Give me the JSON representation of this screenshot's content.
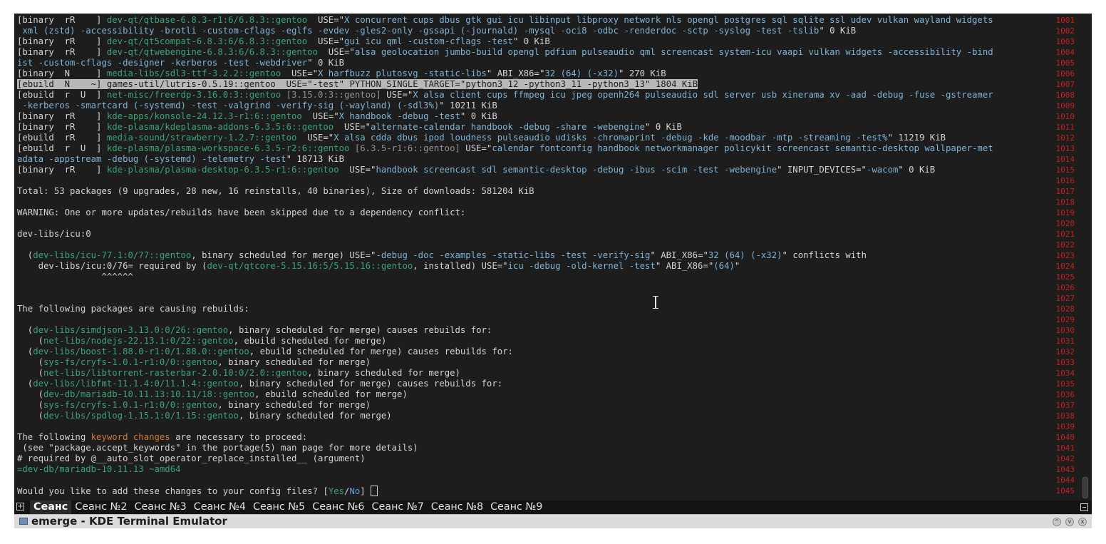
{
  "window": {
    "title": "emerge - KDE Terminal Emulator"
  },
  "tabs": [
    "Сеанс",
    "Сеанс №2",
    "Сеанс №3",
    "Сеанс №4",
    "Сеанс №5",
    "Сеанс №6",
    "Сеанс №7",
    "Сеанс №8",
    "Сеанс №9"
  ],
  "active_tab": 0,
  "terminal_lines": [
    {
      "segs": [
        [
          "[binary  rR    ] ",
          "t"
        ],
        [
          "dev-qt/qtbase-6.8.3-r1:6/6.8.3::gentoo",
          "p"
        ],
        [
          "  USE=\"",
          "t"
        ],
        [
          "X concurrent cups dbus gtk gui icu libinput libproxy network nls opengl postgres sql sqlite ssl udev vulkan wayland widgets",
          "u"
        ]
      ]
    },
    {
      "segs": [
        [
          " xml (zstd) -accessibility -brotli -custom-cflags -eglfs -evdev -gles2-only -gssapi (-journald) -mysql -oci8 -odbc -renderdoc -sctp -syslog -test -tslib",
          "u"
        ],
        [
          "\" 0 KiB",
          "t"
        ]
      ]
    },
    {
      "segs": [
        [
          "[binary  rR    ] ",
          "t"
        ],
        [
          "dev-qt/qt5compat-6.8.3:6/6.8.3::gentoo",
          "p"
        ],
        [
          "  USE=\"",
          "t"
        ],
        [
          "gui icu qml -custom-cflags -test",
          "u"
        ],
        [
          "\" 0 KiB",
          "t"
        ]
      ]
    },
    {
      "segs": [
        [
          "[binary  rR    ] ",
          "t"
        ],
        [
          "dev-qt/qtwebengine-6.8.3:6/6.8.3::gentoo",
          "p"
        ],
        [
          "  USE=\"",
          "t"
        ],
        [
          "alsa geolocation jumbo-build opengl pdfium pulseaudio qml screencast system-icu vaapi vulkan widgets -accessibility -bind",
          "u"
        ]
      ]
    },
    {
      "segs": [
        [
          "ist -custom-cflags -designer -kerberos -test -webdriver",
          "u"
        ],
        [
          "\" 0 KiB",
          "t"
        ]
      ]
    },
    {
      "segs": [
        [
          "[binary  N     ] ",
          "t"
        ],
        [
          "media-libs/sdl3-ttf-3.2.2::gentoo",
          "p"
        ],
        [
          "  USE=\"",
          "t"
        ],
        [
          "X harfbuzz plutosvg -static-libs",
          "u"
        ],
        [
          "\" ABI_X86=\"",
          "t"
        ],
        [
          "32 (64) (-x32)",
          "u"
        ],
        [
          "\" 270 KiB",
          "t"
        ]
      ]
    },
    {
      "hl": true,
      "segs": [
        [
          "[ebuild  N    ~] ",
          "t"
        ],
        [
          "games-util/lutris-0.5.19::gentoo",
          "p"
        ],
        [
          "  USE=\"",
          "t"
        ],
        [
          "-test",
          "u"
        ],
        [
          "\" PYTHON_SINGLE_TARGET=\"",
          "t"
        ],
        [
          "python3_12 -python3_11 -python3_13",
          "u"
        ],
        [
          "\" 1804 KiB",
          "t"
        ]
      ]
    },
    {
      "segs": [
        [
          "[ebuild  r  U  ] ",
          "t"
        ],
        [
          "net-misc/freerdp-3.16.0:3::gentoo",
          "p"
        ],
        [
          " [3.15.0:3::gentoo]",
          "d"
        ],
        [
          " USE=\"",
          "t"
        ],
        [
          "X alsa client cups ffmpeg icu jpeg openh264 pulseaudio sdl server usb xinerama xv -aad -debug -fuse -gstreamer",
          "u"
        ]
      ]
    },
    {
      "segs": [
        [
          " -kerberos -smartcard (-systemd) -test -valgrind -verify-sig (-wayland) (-sdl3%)",
          "u"
        ],
        [
          "\" 10211 KiB",
          "t"
        ]
      ]
    },
    {
      "segs": [
        [
          "[binary  rR    ] ",
          "t"
        ],
        [
          "kde-apps/konsole-24.12.3-r1:6::gentoo",
          "p"
        ],
        [
          "  USE=\"",
          "t"
        ],
        [
          "X handbook -debug -test",
          "u"
        ],
        [
          "\" 0 KiB",
          "t"
        ]
      ]
    },
    {
      "segs": [
        [
          "[binary  rR    ] ",
          "t"
        ],
        [
          "kde-plasma/kdeplasma-addons-6.3.5:6::gentoo",
          "p"
        ],
        [
          "  USE=\"",
          "t"
        ],
        [
          "alternate-calendar handbook -debug -share -webengine",
          "u"
        ],
        [
          "\" 0 KiB",
          "t"
        ]
      ]
    },
    {
      "segs": [
        [
          "[ebuild  rR    ] ",
          "t"
        ],
        [
          "media-sound/strawberry-1.2.7::gentoo",
          "p"
        ],
        [
          "  USE=\"",
          "t"
        ],
        [
          "X alsa cdda dbus ipod loudness pulseaudio udisks -chromaprint -debug -kde -moodbar -mtp -streaming -test%",
          "u"
        ],
        [
          "\" 11219 KiB",
          "t"
        ]
      ]
    },
    {
      "segs": [
        [
          "[ebuild  r  U  ] ",
          "t"
        ],
        [
          "kde-plasma/plasma-workspace-6.3.5-r2:6::gentoo",
          "p"
        ],
        [
          " [6.3.5-r1:6::gentoo]",
          "d"
        ],
        [
          " USE=\"",
          "t"
        ],
        [
          "calendar fontconfig handbook networkmanager policykit screencast semantic-desktop wallpaper-met",
          "u"
        ]
      ]
    },
    {
      "segs": [
        [
          "adata -appstream -debug (-systemd) -telemetry -test",
          "u"
        ],
        [
          "\" 18713 KiB",
          "t"
        ]
      ]
    },
    {
      "segs": [
        [
          "[binary  rR    ] ",
          "t"
        ],
        [
          "kde-plasma/plasma-desktop-6.3.5-r1:6::gentoo",
          "p"
        ],
        [
          "  USE=\"",
          "t"
        ],
        [
          "handbook screencast sdl semantic-desktop -debug -ibus -scim -test -webengine",
          "u"
        ],
        [
          "\" INPUT_DEVICES=\"",
          "t"
        ],
        [
          "-wacom",
          "u"
        ],
        [
          "\" 0 KiB",
          "t"
        ]
      ]
    },
    {
      "segs": []
    },
    {
      "segs": [
        [
          "Total: 53 packages (9 upgrades, 28 new, 16 reinstalls, 40 binaries), Size of downloads: 581204 KiB",
          "t"
        ]
      ]
    },
    {
      "segs": []
    },
    {
      "segs": [
        [
          "WARNING: One or more updates/rebuilds have been skipped due to a dependency conflict:",
          "t"
        ]
      ]
    },
    {
      "segs": []
    },
    {
      "segs": [
        [
          "dev-libs/icu:0",
          "t"
        ]
      ]
    },
    {
      "segs": []
    },
    {
      "segs": [
        [
          "  (",
          "t"
        ],
        [
          "dev-libs/icu-77.1:0/77::gentoo",
          "p"
        ],
        [
          ", binary scheduled for merge) USE=\"",
          "t"
        ],
        [
          "-debug -doc -examples -static-libs -test -verify-sig",
          "u"
        ],
        [
          "\" ABI_X86=\"",
          "t"
        ],
        [
          "32 (64) (-x32)",
          "u"
        ],
        [
          "\" conflicts with",
          "t"
        ]
      ]
    },
    {
      "segs": [
        [
          "    dev-libs/icu:0/76= required by (",
          "t"
        ],
        [
          "dev-qt/qtcore-5.15.16:5/5.15.16::gentoo",
          "p"
        ],
        [
          ", installed) USE=\"",
          "t"
        ],
        [
          "icu -debug -old-kernel -test",
          "u"
        ],
        [
          "\" ABI_X86=\"",
          "t"
        ],
        [
          "(64)",
          "u"
        ],
        [
          "\"",
          "t"
        ]
      ]
    },
    {
      "segs": [
        [
          "                ^^^^^^",
          "t"
        ]
      ]
    },
    {
      "segs": []
    },
    {
      "segs": []
    },
    {
      "segs": [
        [
          "The following packages are causing rebuilds:",
          "t"
        ]
      ]
    },
    {
      "segs": []
    },
    {
      "segs": [
        [
          "  (",
          "t"
        ],
        [
          "dev-libs/simdjson-3.13.0:0/26::gentoo",
          "p"
        ],
        [
          ", binary scheduled for merge) causes rebuilds for:",
          "t"
        ]
      ]
    },
    {
      "segs": [
        [
          "    (",
          "t"
        ],
        [
          "net-libs/nodejs-22.13.1:0/22::gentoo",
          "p"
        ],
        [
          ", ebuild scheduled for merge)",
          "t"
        ]
      ]
    },
    {
      "segs": [
        [
          "  (",
          "t"
        ],
        [
          "dev-libs/boost-1.88.0-r1:0/1.88.0::gentoo",
          "p"
        ],
        [
          ", ebuild scheduled for merge) causes rebuilds for:",
          "t"
        ]
      ]
    },
    {
      "segs": [
        [
          "    (",
          "t"
        ],
        [
          "sys-fs/cryfs-1.0.1-r1:0/0::gentoo",
          "p"
        ],
        [
          ", binary scheduled for merge)",
          "t"
        ]
      ]
    },
    {
      "segs": [
        [
          "    (",
          "t"
        ],
        [
          "net-libs/libtorrent-rasterbar-2.0.10:0/2.0::gentoo",
          "p"
        ],
        [
          ", binary scheduled for merge)",
          "t"
        ]
      ]
    },
    {
      "segs": [
        [
          "  (",
          "t"
        ],
        [
          "dev-libs/libfmt-11.1.4:0/11.1.4::gentoo",
          "p"
        ],
        [
          ", binary scheduled for merge) causes rebuilds for:",
          "t"
        ]
      ]
    },
    {
      "segs": [
        [
          "    (",
          "t"
        ],
        [
          "dev-db/mariadb-10.11.13:10.11/18::gentoo",
          "p"
        ],
        [
          ", ebuild scheduled for merge)",
          "t"
        ]
      ]
    },
    {
      "segs": [
        [
          "    (",
          "t"
        ],
        [
          "sys-fs/cryfs-1.0.1-r1:0/0::gentoo",
          "p"
        ],
        [
          ", binary scheduled for merge)",
          "t"
        ]
      ]
    },
    {
      "segs": [
        [
          "    (",
          "t"
        ],
        [
          "dev-libs/spdlog-1.15.1:0/1.15::gentoo",
          "p"
        ],
        [
          ", binary scheduled for merge)",
          "t"
        ]
      ]
    },
    {
      "segs": []
    },
    {
      "segs": [
        [
          "The following ",
          "t"
        ],
        [
          "keyword changes",
          "k"
        ],
        [
          " are necessary to proceed:",
          "t"
        ]
      ]
    },
    {
      "segs": [
        [
          " (see \"package.accept_keywords\" in the portage(5) man page for more details)",
          "t"
        ]
      ]
    },
    {
      "segs": [
        [
          "# required by @__auto_slot_operator_replace_installed__ (argument)",
          "t"
        ]
      ]
    },
    {
      "segs": [
        [
          "=dev-db/mariadb-10.11.13 ~amd64",
          "p"
        ]
      ]
    },
    {
      "segs": []
    },
    {
      "cursor": true,
      "segs": [
        [
          "Would you like to add these changes to your config files? [",
          "t"
        ],
        [
          "Yes",
          "y"
        ],
        [
          "/",
          "t"
        ],
        [
          "No",
          "n"
        ],
        [
          "] ",
          "t"
        ]
      ]
    }
  ],
  "line_numbers": [
    "1001",
    "1002",
    "1003",
    "1004",
    "1005",
    "1006",
    "1007",
    "1008",
    "1009",
    "1010",
    "1011",
    "1012",
    "1013",
    "1014",
    "1015",
    "1016",
    "1017",
    "1018",
    "1019",
    "1020",
    "1021",
    "1022",
    "1023",
    "1024",
    "1025",
    "1026",
    "1027",
    "1028",
    "1029",
    "1030",
    "1031",
    "1032",
    "1033",
    "1034",
    "1035",
    "1036",
    "1037",
    "1038",
    "1039",
    "1040",
    "1041",
    "1042",
    "1043",
    "1044",
    "1045"
  ],
  "colors": {
    "package": "#3aa374",
    "use_flags": "#7fb2d4",
    "line_numbers": "#c81e1e",
    "keyword": "#d07a3a",
    "highlight": "#b8b8b8",
    "background": "#1d1d1d"
  }
}
